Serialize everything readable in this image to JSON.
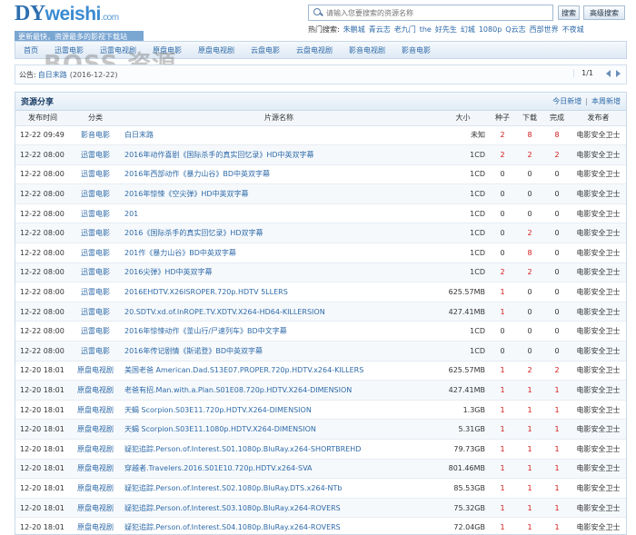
{
  "site": {
    "logo_dy": "DY",
    "logo_weishi": "weishi",
    "logo_domain": ".com",
    "tagline": "更新最快，资源最多的影视下载站"
  },
  "search": {
    "placeholder": "请输入您要搜索的资源名称",
    "button": "搜索",
    "advanced_button": "高级搜索"
  },
  "hot": {
    "label": "热门搜索:",
    "keywords": [
      "朱鹏城",
      "青云志",
      "老九门",
      "the",
      "好先生",
      "幻城",
      "1080p",
      "Q云志",
      "西部世界",
      "不夜城"
    ]
  },
  "nav": {
    "items": [
      "首页",
      "迅雷电影",
      "迅雷电视剧",
      "原盘电影",
      "原盘电视剧",
      "云盘电影",
      "云盘电视剧",
      "影音电视剧",
      "影音电影"
    ]
  },
  "watermark": "BOSS 资源",
  "notice": {
    "label": "公告:",
    "text": "自日末路",
    "date": "(2016-12-22)",
    "pager": "1/1"
  },
  "panel": {
    "title": "资源分享",
    "link_today": "今日新增",
    "link_week": "本周新增"
  },
  "columns": [
    "发布时间",
    "分类",
    "片源名称",
    "大小",
    "种子",
    "下载",
    "完成",
    "发布者"
  ],
  "rows": [
    {
      "time": "12-22 09:49",
      "cat": "影音电影",
      "name": "白日末路",
      "size": "未知",
      "seed": "2",
      "dl": "8",
      "done": "8",
      "pub": "电影安全卫士"
    },
    {
      "time": "12-22 08:00",
      "cat": "迅雷电影",
      "name": "2016年动作喜剧《国际杀手的真实回忆录》HD中英双字幕",
      "size": "1CD",
      "seed": "2",
      "dl": "2",
      "done": "2",
      "pub": "电影安全卫士"
    },
    {
      "time": "12-22 08:00",
      "cat": "迅雷电影",
      "name": "2016年西部动作《暴力山谷》BD中英双字幕",
      "size": "1CD",
      "seed": "0",
      "dl": "0",
      "done": "0",
      "pub": "电影安全卫士"
    },
    {
      "time": "12-22 08:00",
      "cat": "迅雷电影",
      "name": "2016年惊悚《空尖弹》HD中英双字幕",
      "size": "1CD",
      "seed": "0",
      "dl": "0",
      "done": "0",
      "pub": "电影安全卫士"
    },
    {
      "time": "12-22 08:00",
      "cat": "迅雷电影",
      "name": "201",
      "size": "1CD",
      "seed": "0",
      "dl": "0",
      "done": "0",
      "pub": "电影安全卫士"
    },
    {
      "time": "12-22 08:00",
      "cat": "迅雷电影",
      "name": "2016《国际杀手的真实回忆录》HD双字幕",
      "size": "1CD",
      "seed": "0",
      "dl": "2",
      "done": "0",
      "pub": "电影安全卫士"
    },
    {
      "time": "12-22 08:00",
      "cat": "迅雷电影",
      "name": "201作《暴力山谷》BD中英双字幕",
      "size": "1CD",
      "seed": "0",
      "dl": "8",
      "done": "0",
      "pub": "电影安全卫士"
    },
    {
      "time": "12-22 08:00",
      "cat": "迅雷电影",
      "name": "2016尖弹》HD中英双字幕",
      "size": "1CD",
      "seed": "2",
      "dl": "2",
      "done": "0",
      "pub": "电影安全卫士"
    },
    {
      "time": "12-22 08:00",
      "cat": "迅雷电影",
      "name": "2016EHDTV.X26ISROPER.720p.HDTV 5LLERS",
      "size": "625.57MB",
      "seed": "1",
      "dl": "0",
      "done": "0",
      "pub": "电影安全卫士"
    },
    {
      "time": "12-22 08:00",
      "cat": "迅雷电影",
      "name": "20.SDTV.xd.of.InROPE.TV.XDTV.X264-HD64-KILLERSION",
      "size": "427.41MB",
      "seed": "1",
      "dl": "0",
      "done": "0",
      "pub": "电影安全卫士"
    },
    {
      "time": "12-22 08:00",
      "cat": "迅雷电影",
      "name": "2016年惊悚动作《釜山行/尸速列车》BD中文字幕",
      "size": "1CD",
      "seed": "0",
      "dl": "0",
      "done": "0",
      "pub": "电影安全卫士"
    },
    {
      "time": "12-22 08:00",
      "cat": "迅雷电影",
      "name": "2016年传记剧情《斯诺登》BD中英双字幕",
      "size": "1CD",
      "seed": "0",
      "dl": "0",
      "done": "0",
      "pub": "电影安全卫士"
    },
    {
      "time": "12-20 18:01",
      "cat": "原盘电视剧",
      "name": "美国老爸 American.Dad.S13E07.PROPER.720p.HDTV.x264-KILLERS",
      "size": "625.57MB",
      "seed": "1",
      "dl": "2",
      "done": "2",
      "pub": "电影安全卫士"
    },
    {
      "time": "12-20 18:01",
      "cat": "原盘电视剧",
      "name": "老爸有招.Man.with.a.Plan.S01E08.720p.HDTV.X264-DIMENSION",
      "size": "427.41MB",
      "seed": "1",
      "dl": "1",
      "done": "1",
      "pub": "电影安全卫士"
    },
    {
      "time": "12-20 18:01",
      "cat": "原盘电视剧",
      "name": "天蝎 Scorpion.S03E11.720p.HDTV.X264-DIMENSION",
      "size": "1.3GB",
      "seed": "1",
      "dl": "1",
      "done": "1",
      "pub": "电影安全卫士"
    },
    {
      "time": "12-20 18:01",
      "cat": "原盘电视剧",
      "name": "天蝎 Scorpion.S03E11.1080p.HDTV.X264-DIMENSION",
      "size": "5.31GB",
      "seed": "1",
      "dl": "1",
      "done": "1",
      "pub": "电影安全卫士"
    },
    {
      "time": "12-20 18:01",
      "cat": "原盘电视剧",
      "name": "疑犯追踪.Person.of.Interest.S01.1080p.BluRay.x264-SHORTBREHD",
      "size": "79.73GB",
      "seed": "1",
      "dl": "1",
      "done": "1",
      "pub": "电影安全卫士"
    },
    {
      "time": "12-20 18:01",
      "cat": "原盘电视剧",
      "name": "穿越者.Travelers.2016.S01E10.720p.HDTV.x264-SVA",
      "size": "801.46MB",
      "seed": "1",
      "dl": "1",
      "done": "1",
      "pub": "电影安全卫士"
    },
    {
      "time": "12-20 18:01",
      "cat": "原盘电视剧",
      "name": "疑犯追踪.Person.of.Interest.S02.1080p.BluRay.DTS.x264-NTb",
      "size": "85.53GB",
      "seed": "1",
      "dl": "1",
      "done": "1",
      "pub": "电影安全卫士"
    },
    {
      "time": "12-20 18:01",
      "cat": "原盘电视剧",
      "name": "疑犯追踪.Person.of.Interest.S03.1080p.BluRay.x264-ROVERS",
      "size": "75.32GB",
      "seed": "1",
      "dl": "1",
      "done": "1",
      "pub": "电影安全卫士"
    },
    {
      "time": "12-20 18:01",
      "cat": "原盘电视剧",
      "name": "疑犯追踪.Person.of.Interest.S04.1080p.BluRay.x264-ROVERS",
      "size": "72.04GB",
      "seed": "1",
      "dl": "1",
      "done": "1",
      "pub": "电影安全卫士"
    }
  ],
  "colors": {
    "link": "#2e6aa8",
    "count_red": "#d31818",
    "border": "#c9d9e9"
  }
}
